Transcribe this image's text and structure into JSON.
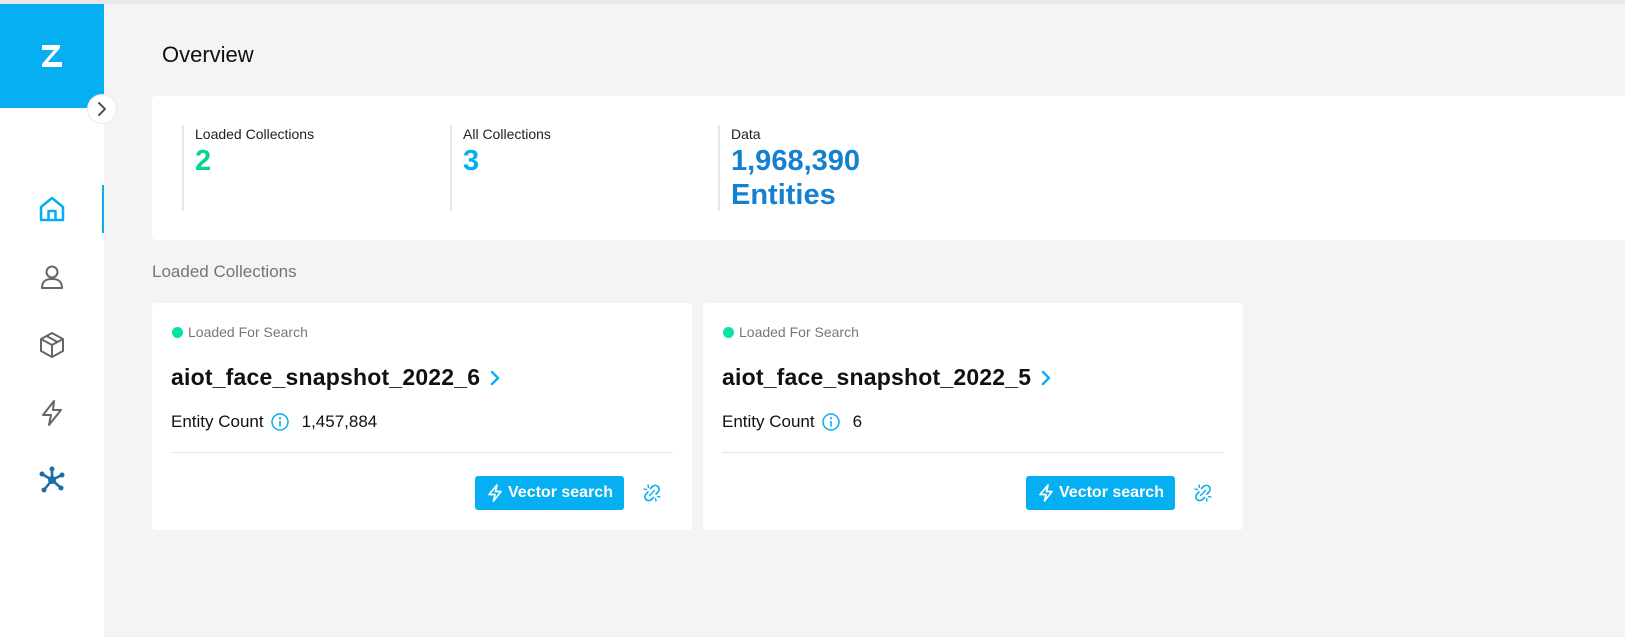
{
  "page": {
    "title": "Overview"
  },
  "sidebar": {
    "logo": "milvus-logo-icon",
    "items": [
      {
        "icon": "home-icon",
        "active": true
      },
      {
        "icon": "user-icon",
        "active": false
      },
      {
        "icon": "cube-icon",
        "active": false
      },
      {
        "icon": "lightning-icon",
        "active": false
      },
      {
        "icon": "plugin-icon",
        "active": false
      }
    ]
  },
  "stats": [
    {
      "label": "Loaded Collections",
      "value": "2",
      "color": "#06d58c"
    },
    {
      "label": "All Collections",
      "value": "3",
      "color": "#06aff2"
    },
    {
      "label": "Data",
      "value": "1,968,390",
      "unit": "Entities",
      "color": "#1380d1"
    }
  ],
  "section_title": "Loaded Collections",
  "collections": [
    {
      "status": "Loaded For Search",
      "name": "aiot_face_snapshot_2022_6",
      "count_label": "Entity Count",
      "count": "1,457,884",
      "button_label": "Vector search"
    },
    {
      "status": "Loaded For Search",
      "name": "aiot_face_snapshot_2022_5",
      "count_label": "Entity Count",
      "count": "6",
      "button_label": "Vector search"
    }
  ],
  "colors": {
    "accent": "#06aff2",
    "status_green": "#06e3a5"
  }
}
